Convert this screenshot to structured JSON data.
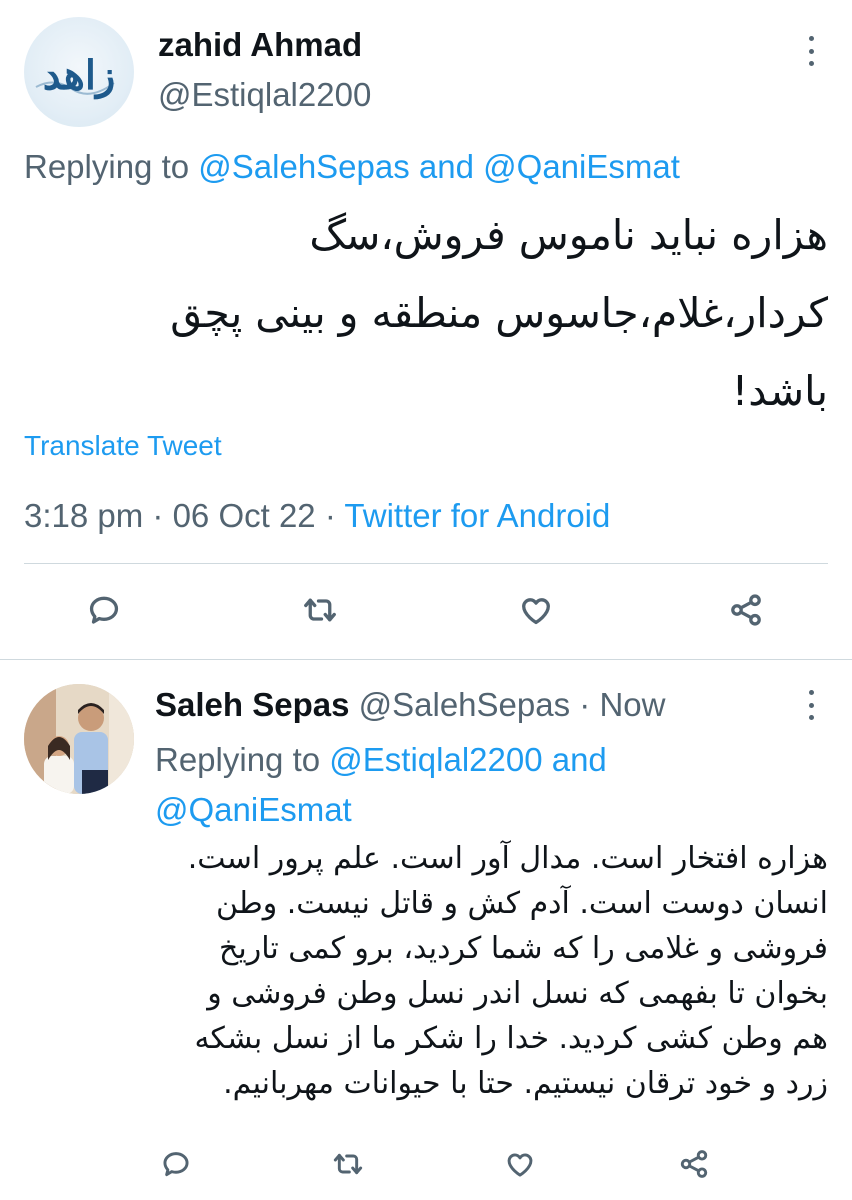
{
  "tweet1": {
    "name": "zahid Ahmad",
    "handle": "@Estiqlal2200",
    "avatar_text": "زاهد",
    "replying_prefix": "Replying to ",
    "reply_user1": "@SalehSepas",
    "reply_and": " and ",
    "reply_user2": "@QaniEsmat",
    "text_line1": "هزاره نباید ناموس فروش،سگ",
    "text_line2": "کردار،غلام،جاسوس منطقه و بینی پچق",
    "text_line3": "باشد!",
    "translate_label": "Translate Tweet",
    "time": "3:18 pm",
    "date": "06 Oct 22",
    "separator": " · ",
    "source": "Twitter for Android"
  },
  "tweet2": {
    "name": "Saleh Sepas",
    "handle": "@SalehSepas",
    "separator": " · ",
    "time": "Now",
    "replying_prefix": "Replying to ",
    "reply_user1": "@Estiqlal2200",
    "reply_and": " and ",
    "reply_user2": "@QaniEsmat",
    "text_lines": [
      "هزاره افتخار است. مدال آور است. علم پرور است.",
      "انسان دوست است. آدم کش و قاتل نیست. وطن",
      "فروشی و غلامی را که شما کردید، برو کمی تاریخ",
      "بخوان تا بفهمی که نسل اندر نسل وطن فروشی و",
      "هم وطن کشی کردید. خدا را شکر ما از نسل بشکه",
      "زرد و خود ترقان نیستیم. حتا با حیوانات مهربانیم."
    ]
  },
  "icons": [
    "more-icon",
    "reply-icon",
    "retweet-icon",
    "like-icon",
    "share-icon"
  ],
  "colors": {
    "link": "#1d9bf0",
    "secondary": "#536471",
    "text": "#0f1419",
    "divider": "#cfd9de"
  }
}
